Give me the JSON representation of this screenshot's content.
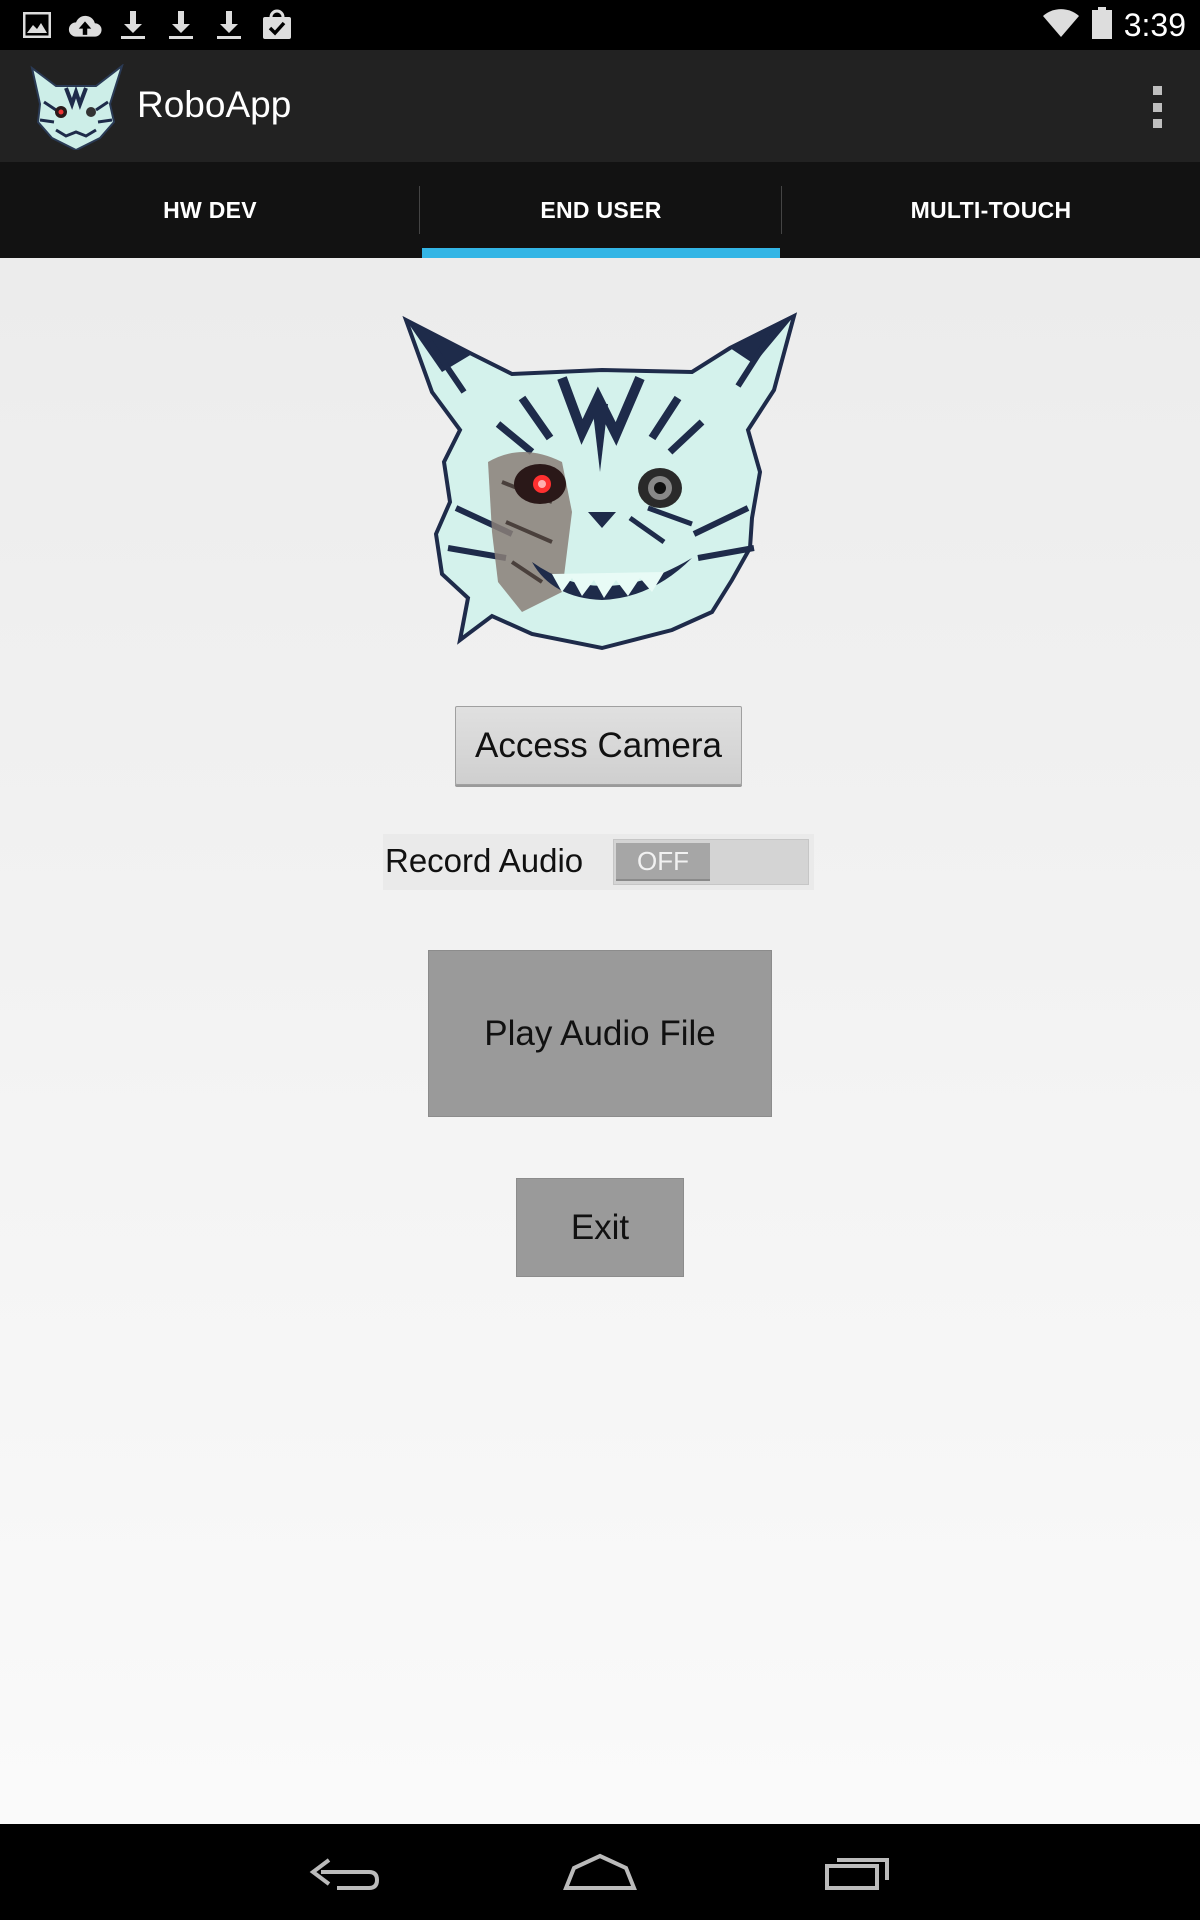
{
  "status_bar": {
    "time": "3:39",
    "notification_icons": [
      "image-icon",
      "cloud-upload-icon",
      "download-icon",
      "download-icon",
      "download-icon",
      "shopping-bag-check-icon"
    ],
    "system_icons": [
      "wifi-icon",
      "battery-icon"
    ]
  },
  "action_bar": {
    "title": "RoboApp",
    "logo_icon": "lynx-logo-icon",
    "overflow_icon": "overflow-menu-icon"
  },
  "tabs": [
    {
      "label": "HW DEV",
      "active": false
    },
    {
      "label": "END USER",
      "active": true
    },
    {
      "label": "MULTI-TOUCH",
      "active": false
    }
  ],
  "accent_color": "#33b5e5",
  "main": {
    "image_icon": "cyborg-lynx-image",
    "camera_button": "Access Camera",
    "record_audio": {
      "label": "Record Audio",
      "switch_state": "OFF"
    },
    "play_button": "Play Audio File",
    "exit_button": "Exit"
  },
  "nav_bar": {
    "icons": [
      "back-icon",
      "home-icon",
      "recent-apps-icon"
    ]
  }
}
